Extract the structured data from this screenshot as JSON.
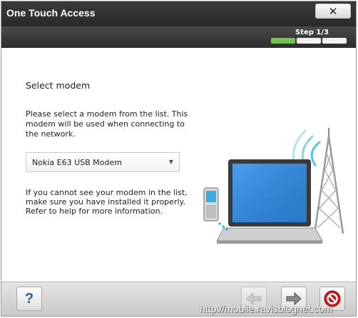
{
  "window": {
    "title": "One Touch Access",
    "close_symbol": "✕"
  },
  "wizard": {
    "step_label": "Step 1/3",
    "progress": {
      "current": 1,
      "total": 3
    }
  },
  "main": {
    "heading": "Select modem",
    "description": "Please select a modem from the list. This modem will be used when connecting to the network.",
    "modem_select": {
      "selected": "Nokia E63 USB Modem"
    },
    "help_text": "If you cannot see your modem in the list, make sure you have installed it properly. Refer to help for more information."
  },
  "footer": {
    "help_label": "?"
  },
  "illustration": {
    "icon": "phone-laptop-tower-illustration"
  },
  "watermark": {
    "text": "http://mobile.ravisblognet.com"
  },
  "colors": {
    "progress_active": "#73c24a",
    "title_bar": "#2f2f2f"
  }
}
